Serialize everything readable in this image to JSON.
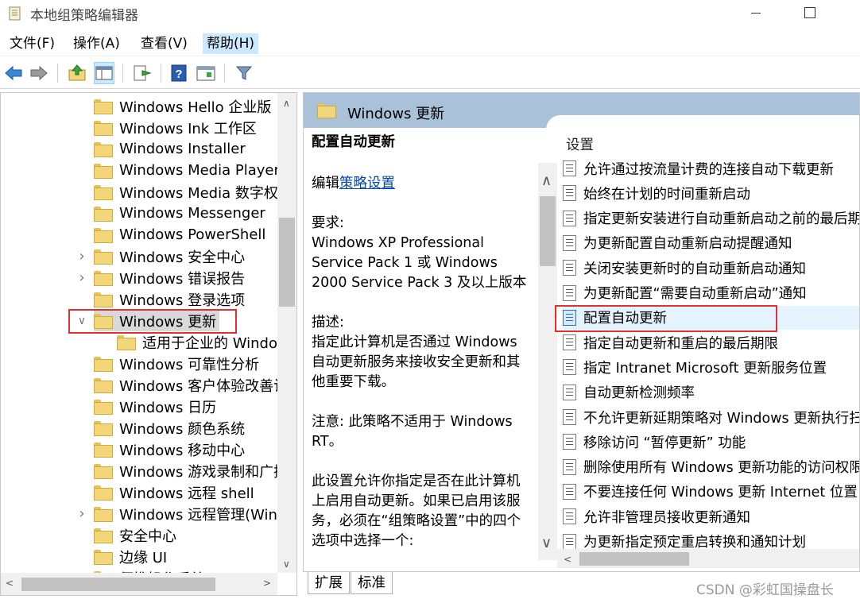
{
  "window": {
    "title": "本地组策略编辑器"
  },
  "menu": [
    "文件(F)",
    "操作(A)",
    "查看(V)",
    "帮助(H)"
  ],
  "toolbar": {
    "icons": [
      "back-icon",
      "forward-icon",
      "up-folder-icon",
      "show-hide-tree-icon",
      "export-list-icon",
      "help-icon",
      "properties-icon",
      "filter-icon"
    ]
  },
  "tree": {
    "items": [
      {
        "label": "Windows Hello 企业版",
        "expandable": false
      },
      {
        "label": "Windows Ink 工作区",
        "expandable": false
      },
      {
        "label": "Windows Installer",
        "expandable": false
      },
      {
        "label": "Windows Media Player",
        "expandable": false
      },
      {
        "label": "Windows Media 数字权限",
        "expandable": false
      },
      {
        "label": "Windows Messenger",
        "expandable": false
      },
      {
        "label": "Windows PowerShell",
        "expandable": false
      },
      {
        "label": "Windows 安全中心",
        "expandable": true
      },
      {
        "label": "Windows 错误报告",
        "expandable": true
      },
      {
        "label": "Windows 登录选项",
        "expandable": false
      },
      {
        "label": "Windows 更新",
        "expandable": true,
        "expanded": true,
        "selected": true
      },
      {
        "label": "适用于企业的 Windows",
        "child": true
      },
      {
        "label": "Windows 可靠性分析",
        "expandable": false
      },
      {
        "label": "Windows 客户体验改善计",
        "expandable": false
      },
      {
        "label": "Windows 日历",
        "expandable": false
      },
      {
        "label": "Windows 颜色系统",
        "expandable": false
      },
      {
        "label": "Windows 移动中心",
        "expandable": false
      },
      {
        "label": "Windows 游戏录制和广播",
        "expandable": false
      },
      {
        "label": "Windows 远程 shell",
        "expandable": false
      },
      {
        "label": "Windows 远程管理(WinR",
        "expandable": true
      },
      {
        "label": "安全中心",
        "expandable": false
      },
      {
        "label": "边缘 UI",
        "expandable": false
      },
      {
        "label": "便携操作系统",
        "expandable": false
      }
    ]
  },
  "details": {
    "header": "Windows 更新",
    "title": "配置自动更新",
    "edit_prefix": "编辑",
    "edit_link": "策略设置",
    "requirements_label": "要求:",
    "requirements": "Windows XP Professional Service Pack 1 或 Windows 2000 Service Pack 3 及以上版本",
    "description_label": "描述:",
    "description": "指定此计算机是否通过 Windows 自动更新服务来接收安全更新和其他重要下载。",
    "note": "注意: 此策略不适用于 Windows RT。",
    "more": "此设置允许你指定是否在此计算机上启用自动更新。如果已启用该服务，必须在“组策略设置”中的四个选项中选择一个:"
  },
  "settings": {
    "header": "设置",
    "items": [
      "允许通过按流量计费的连接自动下载更新",
      "始终在计划的时间重新启动",
      "指定更新安装进行自动重新启动之前的最后期",
      "为更新配置自动重新启动提醒通知",
      "关闭安装更新时的自动重新启动通知",
      "为更新配置“需要自动重新启动”通知",
      "配置自动更新",
      "指定自动更新和重启的最后期限",
      "指定 Intranet Microsoft 更新服务位置",
      "自动更新检测频率",
      "不允许更新延期策略对 Windows 更新执行扫",
      "移除访问 “暂停更新” 功能",
      "删除使用所有 Windows 更新功能的访问权限",
      "不要连接任何 Windows 更新 Internet 位置",
      "允许非管理员接收更新通知",
      "为更新指定预定重启转换和通知计划"
    ],
    "selected_index": 6
  },
  "tabs": [
    "扩展",
    "标准"
  ],
  "watermark": "CSDN @彩虹国操盘长"
}
